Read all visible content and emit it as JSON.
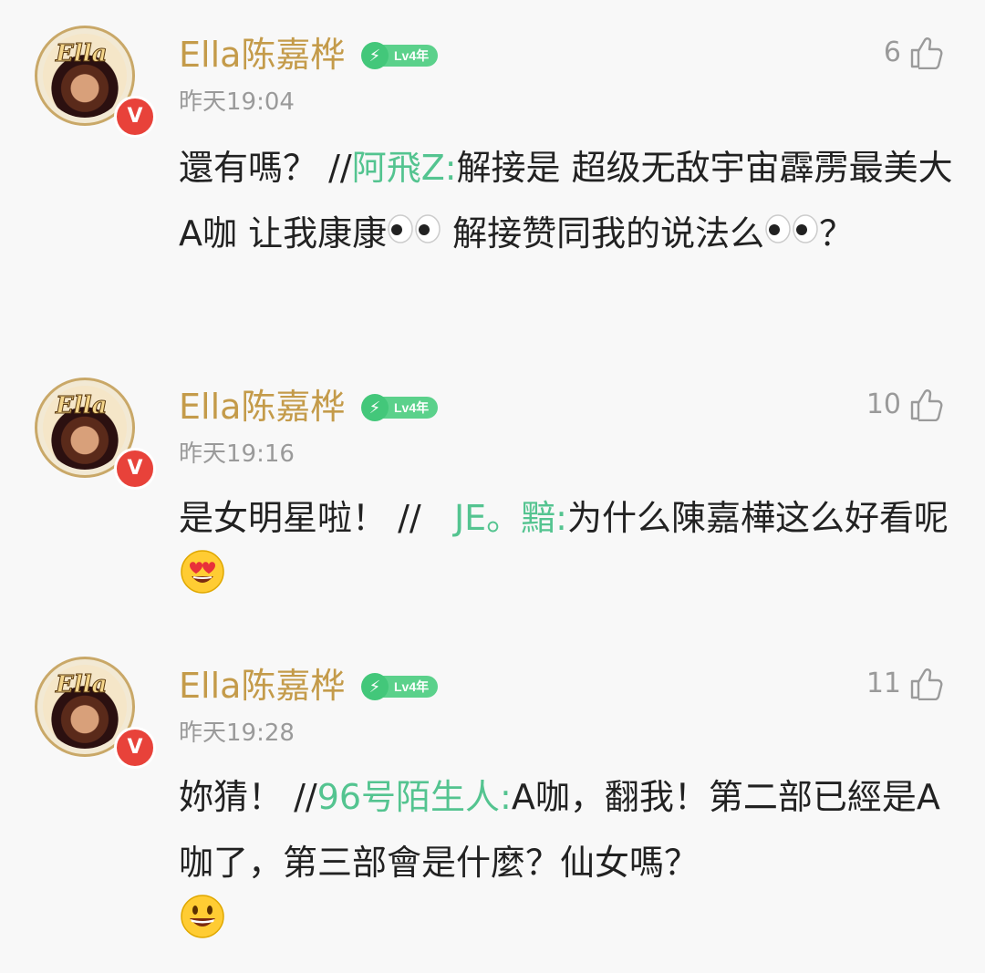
{
  "colors": {
    "username": "#c49b4a",
    "quote": "#54c490",
    "meta": "#9a9a9a",
    "badge_v": "#e8423a",
    "level": "#43c77a"
  },
  "comments": [
    {
      "username": "Ella陈嘉桦",
      "level": "Lv4年",
      "timestamp": "昨天19:04",
      "likes": "6",
      "text_before": "還有嗎？ //",
      "quote_user": "阿飛Z:",
      "text_after_1": "解接是 超级无敌宇宙霹雳最美大A咖 让我康康",
      "emoji_1": "eyes",
      "text_after_2": " 解接赞同我的说法么",
      "emoji_2": "eyes",
      "text_after_3": "？"
    },
    {
      "username": "Ella陈嘉桦",
      "level": "Lv4年",
      "timestamp": "昨天19:16",
      "likes": "10",
      "text_before": "是女明星啦！ //",
      "quote_user": "JE。黯:",
      "text_after_1": "为什么陳嘉樺这么好看呢",
      "emoji_1": "heart-eyes"
    },
    {
      "username": "Ella陈嘉桦",
      "level": "Lv4年",
      "timestamp": "昨天19:28",
      "likes": "11",
      "text_before": "妳猜！ //",
      "quote_user": "96号陌生人:",
      "text_after_1": "A咖，翻我！第二部已經是A咖了，第三部會是什麼？仙女嗎？",
      "emoji_1": "grin"
    }
  ],
  "icons": {
    "like": "thumbs-up-icon",
    "verified": "verified-v-icon",
    "level": "lightning-icon"
  },
  "badge_text": "V"
}
